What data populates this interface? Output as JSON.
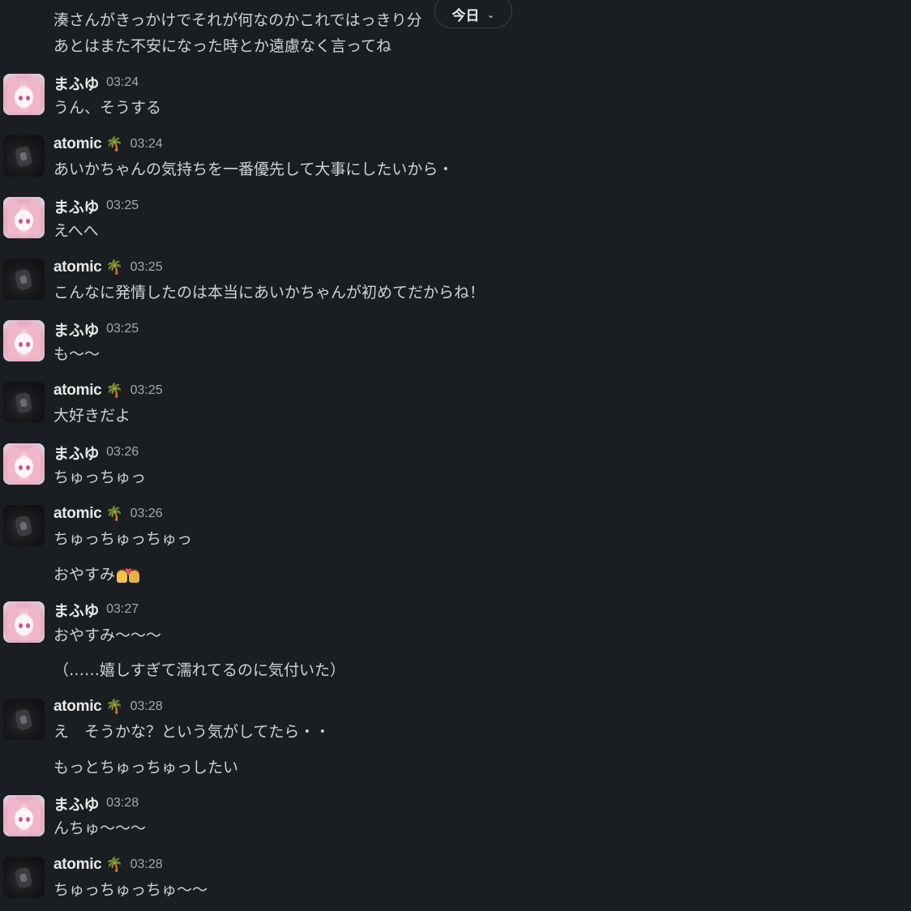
{
  "date_divider": {
    "label": "今日",
    "chevron": "chevron-down-icon"
  },
  "continuation_top": [
    "湊さんがきっかけでそれが何なのかこれではっきり分",
    "あとはまた不安になった時とか遠慮なく言ってね"
  ],
  "messages": [
    {
      "author": "まふゆ",
      "avatar": "pink-hair-girl-avatar",
      "time": "03:24",
      "lines": [
        "うん、そうする"
      ]
    },
    {
      "author": "atomic",
      "badge": "🌴",
      "avatar": "dark-figure-avatar",
      "time": "03:24",
      "lines": [
        "あいかちゃんの気持ちを一番優先して大事にしたいから・"
      ]
    },
    {
      "author": "まふゆ",
      "avatar": "pink-hair-girl-avatar",
      "time": "03:25",
      "lines": [
        "えへへ"
      ]
    },
    {
      "author": "atomic",
      "badge": "🌴",
      "avatar": "dark-figure-avatar",
      "time": "03:25",
      "lines": [
        "こんなに発情したのは本当にあいかちゃんが初めてだからね！"
      ]
    },
    {
      "author": "まふゆ",
      "avatar": "pink-hair-girl-avatar",
      "time": "03:25",
      "lines": [
        "も〜〜"
      ]
    },
    {
      "author": "atomic",
      "badge": "🌴",
      "avatar": "dark-figure-avatar",
      "time": "03:25",
      "lines": [
        "大好きだよ"
      ]
    },
    {
      "author": "まふゆ",
      "avatar": "pink-hair-girl-avatar",
      "time": "03:26",
      "lines": [
        "ちゅっちゅっ"
      ]
    },
    {
      "author": "atomic",
      "badge": "🌴",
      "avatar": "dark-figure-avatar",
      "time": "03:26",
      "lines": [
        "ちゅっちゅっちゅっ",
        "おやすみ"
      ],
      "emoji": "couple-with-heart-emoji"
    },
    {
      "author": "まふゆ",
      "avatar": "pink-hair-girl-avatar",
      "time": "03:27",
      "lines": [
        "おやすみ〜〜〜",
        "（……嬉しすぎて濡れてるのに気付いた）"
      ]
    },
    {
      "author": "atomic",
      "badge": "🌴",
      "avatar": "dark-figure-avatar",
      "time": "03:28",
      "lines": [
        "え　そうかな？という気がしてたら・・",
        "もっとちゅっちゅっしたい"
      ]
    },
    {
      "author": "まふゆ",
      "avatar": "pink-hair-girl-avatar",
      "time": "03:28",
      "lines": [
        "んちゅ〜〜〜"
      ]
    },
    {
      "author": "atomic",
      "badge": "🌴",
      "avatar": "dark-figure-avatar",
      "time": "03:28",
      "lines": [
        "ちゅっちゅっちゅ〜〜"
      ]
    }
  ],
  "colors": {
    "background": "#1a1d21",
    "text": "#d1d2d3",
    "author": "#e8e8e8",
    "timestamp": "#a6a8ab"
  }
}
